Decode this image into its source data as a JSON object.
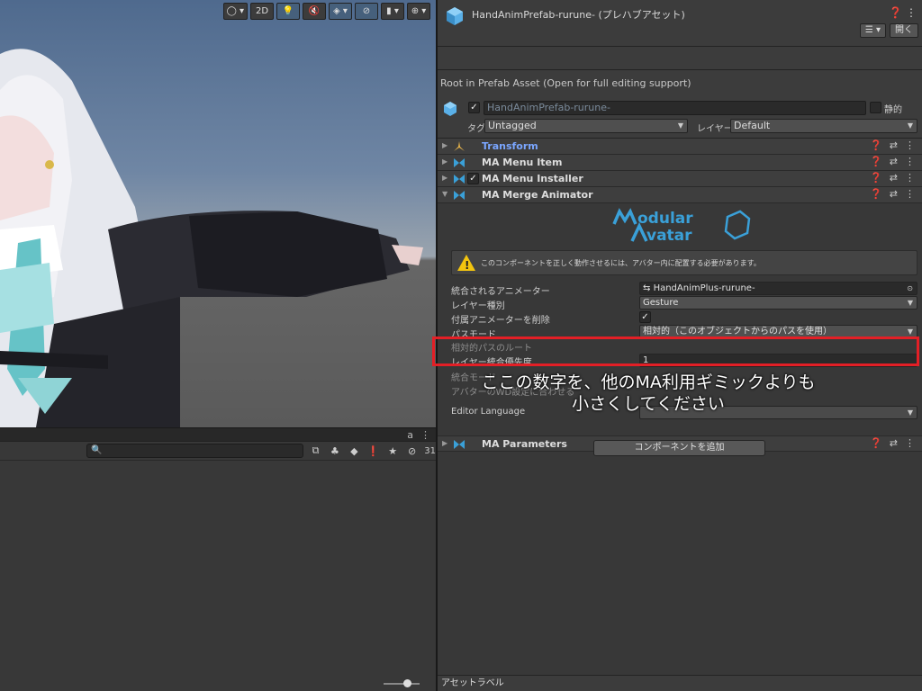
{
  "scene": {
    "toolbar": [
      {
        "name": "draw-mode-button",
        "label": "◯ ▾",
        "on": false
      },
      {
        "name": "2d-toggle",
        "label": "2D",
        "on": false
      },
      {
        "name": "lighting-toggle",
        "label": "💡",
        "on": true
      },
      {
        "name": "audio-toggle",
        "label": "🔇",
        "on": false
      },
      {
        "name": "effects-toggle",
        "label": "◈ ▾",
        "on": true
      },
      {
        "name": "visibility-toggle",
        "label": "⊘",
        "on": true
      },
      {
        "name": "camera-button",
        "label": "▮ ▾",
        "on": false
      },
      {
        "name": "gizmos-button",
        "label": "⊕ ▾",
        "on": false
      }
    ]
  },
  "project": {
    "search_placeholder": "🔍",
    "lock_icon": "a",
    "menu_icon": "⋮",
    "hidden_count": "31"
  },
  "inspector": {
    "title": "HandAnimPrefab-rurune- (プレハブアセット)",
    "help_icon": "❓",
    "menu_icon": "⋮",
    "list_button": "☰ ▾",
    "open_button": "開く",
    "root_info": "Root in Prefab Asset (Open for full editing support)",
    "object_name": "HandAnimPrefab-rurune-",
    "static_label": "静的",
    "tag_label": "タグ",
    "tag_value": "Untagged",
    "layer_label": "レイヤー",
    "layer_value": "Default",
    "components": [
      {
        "name": "Transform",
        "type": "transform"
      },
      {
        "name": "MA Menu Item",
        "type": "ma"
      },
      {
        "name": "MA Menu Installer",
        "type": "ma",
        "checkbox": true
      },
      {
        "name": "MA Merge Animator",
        "type": "ma",
        "expanded": true
      }
    ],
    "logo_line1": "Modular",
    "logo_line2": "Avatar",
    "warning": "このコンポーネントを正しく動作させるには、アバター内に配置する必要があります。",
    "props": {
      "animator_label": "統合されるアニメーター",
      "animator_value": "HandAnimPlus-rurune-",
      "layer_type_label": "レイヤー種別",
      "layer_type_value": "Gesture",
      "delete_label": "付属アニメーターを削除",
      "delete_value": "✓",
      "path_mode_label": "パスモード",
      "path_mode_value": "相対的（このオブジェクトからのパスを使用）",
      "relative_root_label": "相対的パスのルート",
      "priority_label": "レイヤー統合優先度",
      "priority_value": "1",
      "merge_mode_label": "統合モード",
      "align_label": "アバターのWD設定に合わせる",
      "editor_lang_label": "Editor Language"
    },
    "ma_parameters": "MA Parameters",
    "add_component": "コンポーネントを追加",
    "asset_label": "アセットラベル"
  },
  "callout": {
    "line1": "ここの数字を、他のMA利用ギミックよりも",
    "line2": "小さくしてください"
  },
  "colors": {
    "highlight": "#e31f26",
    "ma_icon": "#3aa0d8",
    "transform_name": "#7aa6ff"
  }
}
